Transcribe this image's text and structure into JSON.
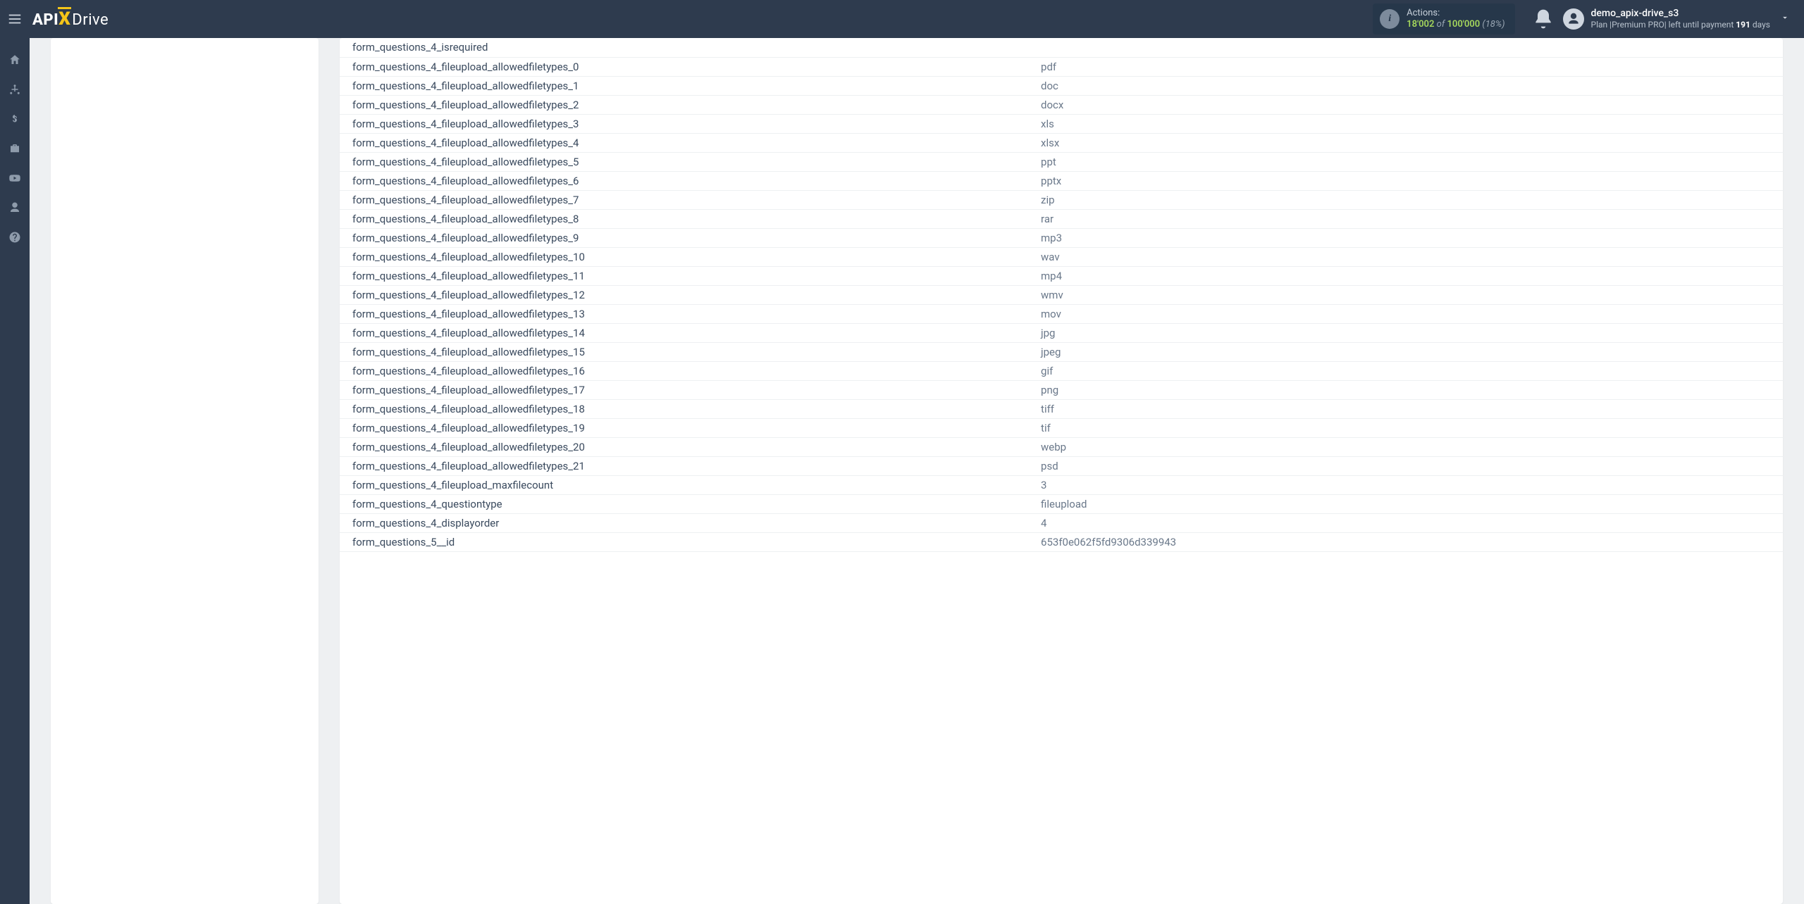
{
  "brand": {
    "part1": "API",
    "part2": "X",
    "part3": "Drive"
  },
  "header": {
    "actions": {
      "label": "Actions:",
      "used": "18'002",
      "of": "of",
      "total": "100'000",
      "pct": "(18%)"
    },
    "user": {
      "name": "demo_apix-drive_s3",
      "plan_prefix": "Plan |",
      "plan_name": "Premium PRO",
      "plan_suffix": "| left until payment ",
      "days": "191",
      "days_word": " days"
    }
  },
  "sidebar_icons": [
    "home",
    "sitemap",
    "dollar",
    "briefcase",
    "youtube",
    "user",
    "help"
  ],
  "rows": [
    {
      "key": "form_questions_4_isrequired",
      "value": ""
    },
    {
      "key": "form_questions_4_fileupload_allowedfiletypes_0",
      "value": "pdf"
    },
    {
      "key": "form_questions_4_fileupload_allowedfiletypes_1",
      "value": "doc"
    },
    {
      "key": "form_questions_4_fileupload_allowedfiletypes_2",
      "value": "docx"
    },
    {
      "key": "form_questions_4_fileupload_allowedfiletypes_3",
      "value": "xls"
    },
    {
      "key": "form_questions_4_fileupload_allowedfiletypes_4",
      "value": "xlsx"
    },
    {
      "key": "form_questions_4_fileupload_allowedfiletypes_5",
      "value": "ppt"
    },
    {
      "key": "form_questions_4_fileupload_allowedfiletypes_6",
      "value": "pptx"
    },
    {
      "key": "form_questions_4_fileupload_allowedfiletypes_7",
      "value": "zip"
    },
    {
      "key": "form_questions_4_fileupload_allowedfiletypes_8",
      "value": "rar"
    },
    {
      "key": "form_questions_4_fileupload_allowedfiletypes_9",
      "value": "mp3"
    },
    {
      "key": "form_questions_4_fileupload_allowedfiletypes_10",
      "value": "wav"
    },
    {
      "key": "form_questions_4_fileupload_allowedfiletypes_11",
      "value": "mp4"
    },
    {
      "key": "form_questions_4_fileupload_allowedfiletypes_12",
      "value": "wmv"
    },
    {
      "key": "form_questions_4_fileupload_allowedfiletypes_13",
      "value": "mov"
    },
    {
      "key": "form_questions_4_fileupload_allowedfiletypes_14",
      "value": "jpg"
    },
    {
      "key": "form_questions_4_fileupload_allowedfiletypes_15",
      "value": "jpeg"
    },
    {
      "key": "form_questions_4_fileupload_allowedfiletypes_16",
      "value": "gif"
    },
    {
      "key": "form_questions_4_fileupload_allowedfiletypes_17",
      "value": "png"
    },
    {
      "key": "form_questions_4_fileupload_allowedfiletypes_18",
      "value": "tiff"
    },
    {
      "key": "form_questions_4_fileupload_allowedfiletypes_19",
      "value": "tif"
    },
    {
      "key": "form_questions_4_fileupload_allowedfiletypes_20",
      "value": "webp"
    },
    {
      "key": "form_questions_4_fileupload_allowedfiletypes_21",
      "value": "psd"
    },
    {
      "key": "form_questions_4_fileupload_maxfilecount",
      "value": "3"
    },
    {
      "key": "form_questions_4_questiontype",
      "value": "fileupload"
    },
    {
      "key": "form_questions_4_displayorder",
      "value": "4"
    },
    {
      "key": "form_questions_5__id",
      "value": "653f0e062f5fd9306d339943"
    }
  ]
}
